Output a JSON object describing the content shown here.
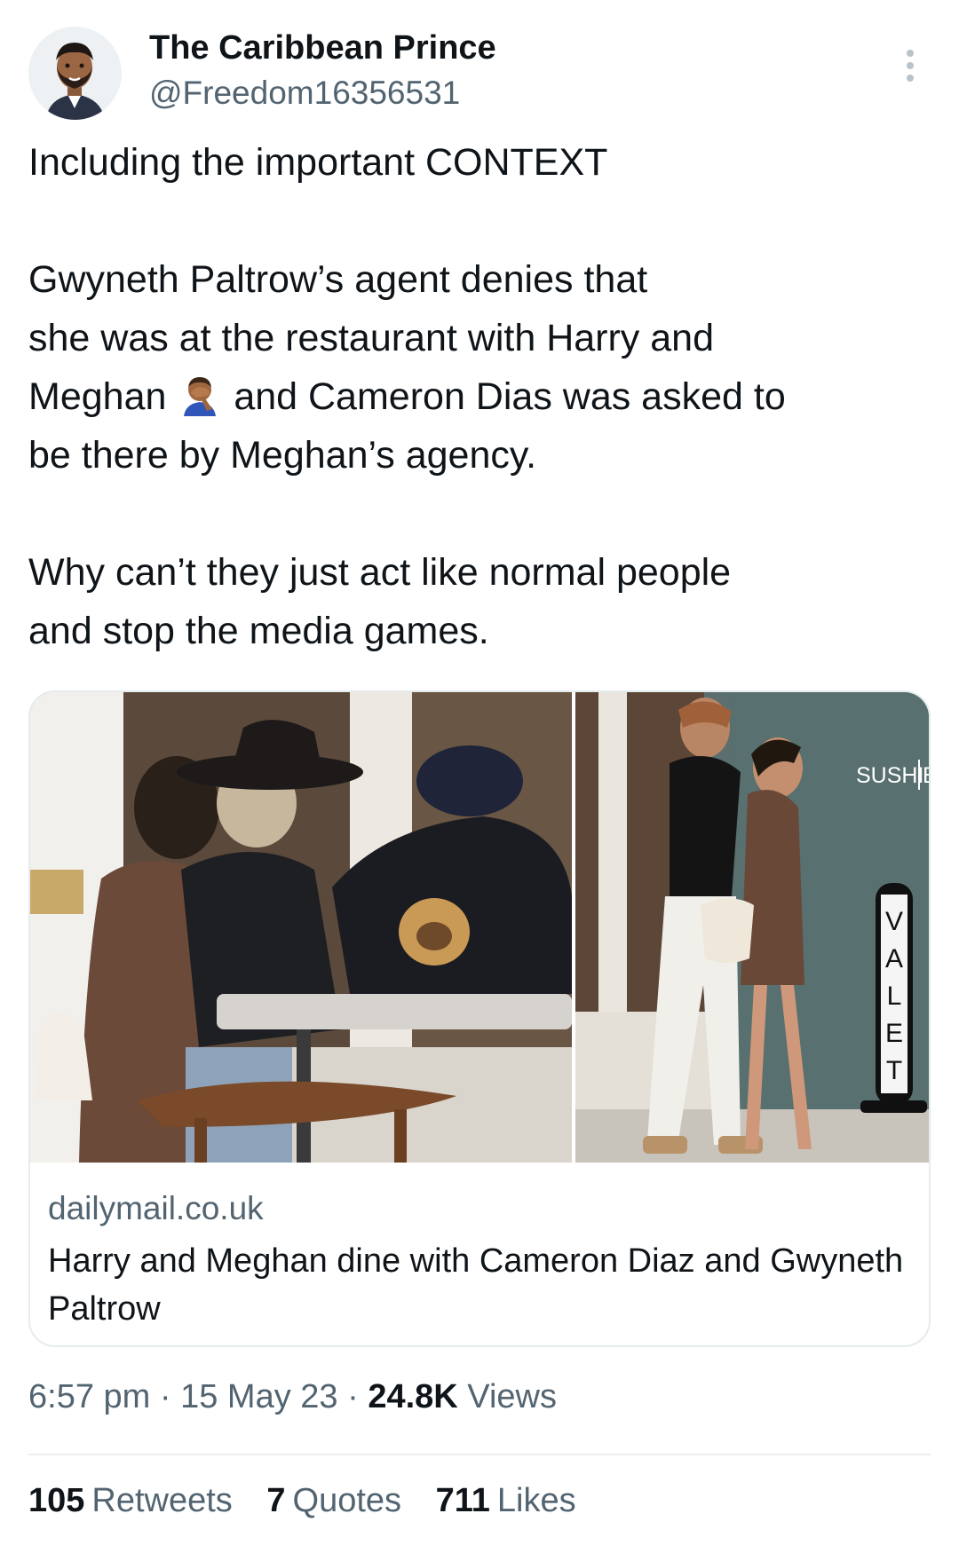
{
  "author": {
    "name": "The Caribbean Prince",
    "handle": "@Freedom16356531"
  },
  "tweet": {
    "line1": "Including the important CONTEXT",
    "para2_line1": "Gwyneth Paltrow’s agent denies that",
    "para2_line2": "she was at the restaurant with Harry and",
    "para2_line3_before": "Meghan",
    "para2_line3_after": "and Cameron Dias was asked to",
    "para2_line4": "be there by Meghan’s agency.",
    "para3_line1": "Why can’t they just act like normal people",
    "para3_line2": "and stop the media games.",
    "emoji": "man-facepalming-icon"
  },
  "card": {
    "sign_sushi": "SUSHI",
    "sign_bar": "BAR",
    "valet_letters": [
      "V",
      "A",
      "L",
      "E",
      "T"
    ],
    "domain": "dailymail.co.uk",
    "headline": "Harry and Meghan dine with Cameron Diaz and Gwyneth Paltrow"
  },
  "meta": {
    "time": "6:57 pm",
    "sep1": " · ",
    "date": "15 May 23",
    "sep2": " · ",
    "views_count": "24.8K",
    "views_label": "Views"
  },
  "stats": {
    "retweets_count": "105",
    "retweets_label": "Retweets",
    "quotes_count": "7",
    "quotes_label": "Quotes",
    "likes_count": "711",
    "likes_label": "Likes"
  },
  "colors": {
    "text": "#0f1419",
    "secondary": "#536471",
    "border": "#e6ebee"
  }
}
